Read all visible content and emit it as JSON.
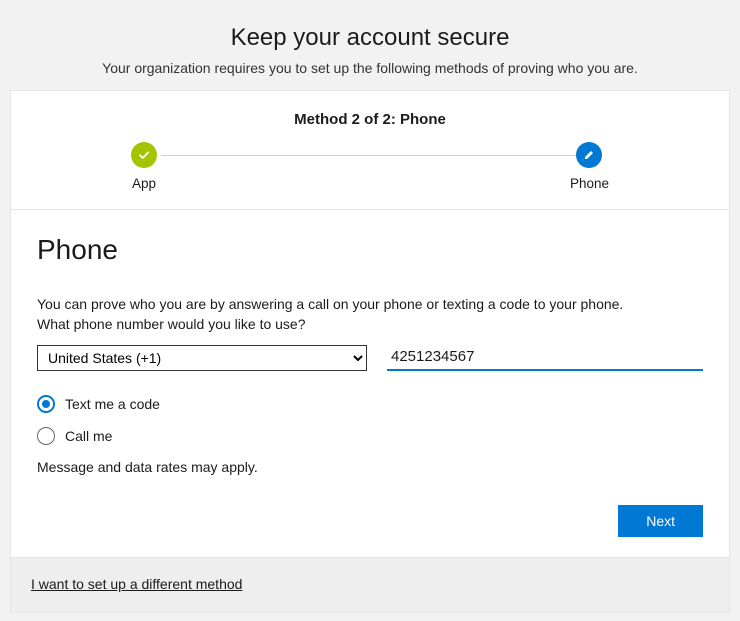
{
  "header": {
    "title": "Keep your account secure",
    "subtitle": "Your organization requires you to set up the following methods of proving who you are."
  },
  "progress": {
    "title": "Method 2 of 2: Phone",
    "step1_label": "App",
    "step2_label": "Phone"
  },
  "form": {
    "section_title": "Phone",
    "instruction1": "You can prove who you are by answering a call on your phone or texting a code to your phone.",
    "instruction2": "What phone number would you like to use?",
    "country_selected": "United States (+1)",
    "phone_value": "4251234567",
    "radio_text": "Text me a code",
    "radio_call": "Call me",
    "rates_notice": "Message and data rates may apply.",
    "next_button": "Next"
  },
  "footer": {
    "alt_method_link": "I want to set up a different method"
  }
}
